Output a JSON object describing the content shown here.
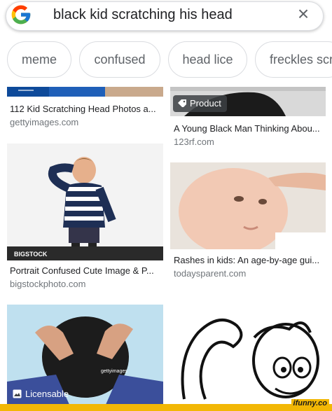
{
  "search": {
    "query": "black kid scratching his head",
    "clear_symbol": "×"
  },
  "chips": [
    "meme",
    "confused",
    "head lice",
    "freckles scratching"
  ],
  "results": [
    {
      "title": "112 Kid Scratching Head Photos a...",
      "domain": "gettyimages.com"
    },
    {
      "title": "A Young Black Man Thinking Abou...",
      "domain": "123rf.com",
      "badge": "Product"
    },
    {
      "title": "Portrait Confused Cute Image & P...",
      "domain": "bigstockphoto.com",
      "watermark": "BIGSTOCK"
    },
    {
      "title": "Rashes in kids: An age-by-age gui...",
      "domain": "todaysparent.com"
    },
    {
      "badge": "Licensable",
      "watermark": "gettyimages"
    }
  ],
  "footer": {
    "site": "ifunny.co"
  },
  "colors": {
    "link_gray": "#70757a",
    "chip_border": "#dadce0",
    "footer_yellow": "#f2b705"
  }
}
